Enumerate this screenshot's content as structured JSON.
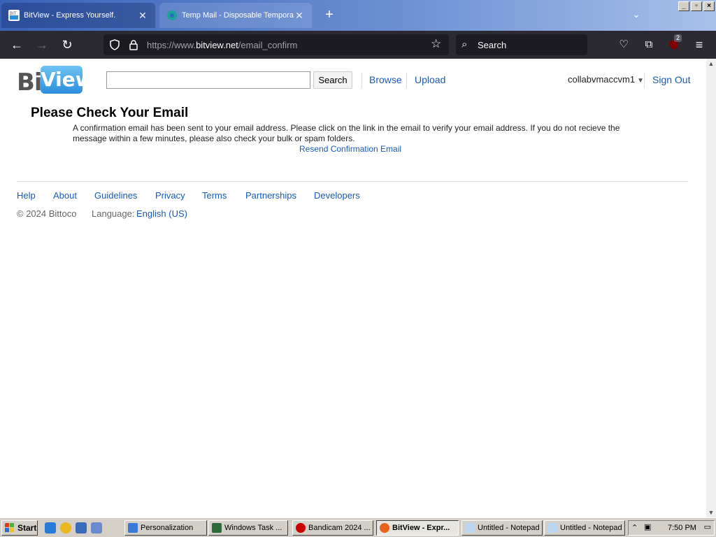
{
  "browser": {
    "tabs": [
      {
        "label": "BitView - Express Yourself.",
        "close": "✕"
      },
      {
        "label": "Temp Mail - Disposable Temporary",
        "close": "✕"
      }
    ],
    "new_tab": "+",
    "url_prefix": "https://www.",
    "url_host": "bitview.net",
    "url_path": "/email_confirm",
    "search_placeholder": "Search",
    "extension_badge": "2"
  },
  "site": {
    "logo_bit": "Bit",
    "logo_view": "View",
    "search_button": "Search",
    "nav_browse": "Browse",
    "nav_upload": "Upload",
    "username": "collabvmaccvm1",
    "sign_out": "Sign Out"
  },
  "main": {
    "title": "Please Check Your Email",
    "message": "A confirmation email has been sent to your email address. Please click on the link in the email to verify your email address. If you do not recieve the message within a few minutes, please also check your bulk or spam folders.",
    "resend_link": "Resend Confirmation Email"
  },
  "footer": {
    "links": [
      "Help",
      "About",
      "Guidelines",
      "Privacy",
      "Terms",
      "Partnerships",
      "Developers"
    ],
    "copyright": "© 2024 Bittoco",
    "language_label": "Language:",
    "language_value": "English (US)"
  },
  "taskbar": {
    "start": "Start",
    "items": [
      {
        "label": "Personalization"
      },
      {
        "label": "Windows Task ..."
      },
      {
        "label": "Bandicam 2024 ..."
      },
      {
        "label": "BitView - Expr..."
      },
      {
        "label": "Untitled - Notepad"
      },
      {
        "label": "Untitled - Notepad"
      }
    ],
    "clock": "7:50 PM"
  }
}
